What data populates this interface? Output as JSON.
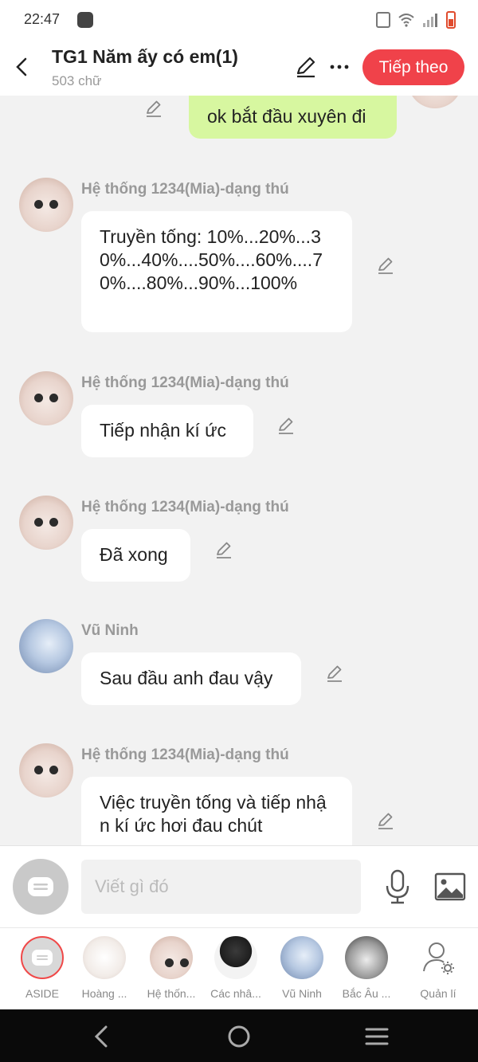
{
  "status_bar": {
    "time": "22:47"
  },
  "header": {
    "title": "TG1 Năm ấy có em(1)",
    "word_count": "503 chữ",
    "next_label": "Tiếp theo",
    "accent_color": "#f0424a"
  },
  "messages": [
    {
      "sender": "",
      "text": "ok bắt đầu xuyên đi",
      "side": "right"
    },
    {
      "sender": "Hệ thống 1234(Mia)-dạng thú",
      "text": "Truyền tống: 10%...20%...30%...40%....50%....60%....70%....80%...90%...100%",
      "side": "left"
    },
    {
      "sender": "Hệ thống 1234(Mia)-dạng thú",
      "text": "Tiếp nhận kí ức",
      "side": "left"
    },
    {
      "sender": "Hệ thống 1234(Mia)-dạng thú",
      "text": "Đã xong",
      "side": "left"
    },
    {
      "sender": "Vũ Ninh",
      "text": "Sau đầu anh đau vậy",
      "side": "left"
    },
    {
      "sender": "Hệ thống 1234(Mia)-dạng thú",
      "text": "Việc truyền tống và tiếp nhận kí ức hơi đau chút",
      "side": "left"
    }
  ],
  "composer": {
    "placeholder": "Viết gì đó"
  },
  "characters": [
    {
      "label": "ASIDE"
    },
    {
      "label": "Hoàng ..."
    },
    {
      "label": "Hệ thốn..."
    },
    {
      "label": "Các nhâ..."
    },
    {
      "label": "Vũ Ninh"
    },
    {
      "label": "Bắc Âu ..."
    },
    {
      "label": "Quản lí"
    }
  ]
}
